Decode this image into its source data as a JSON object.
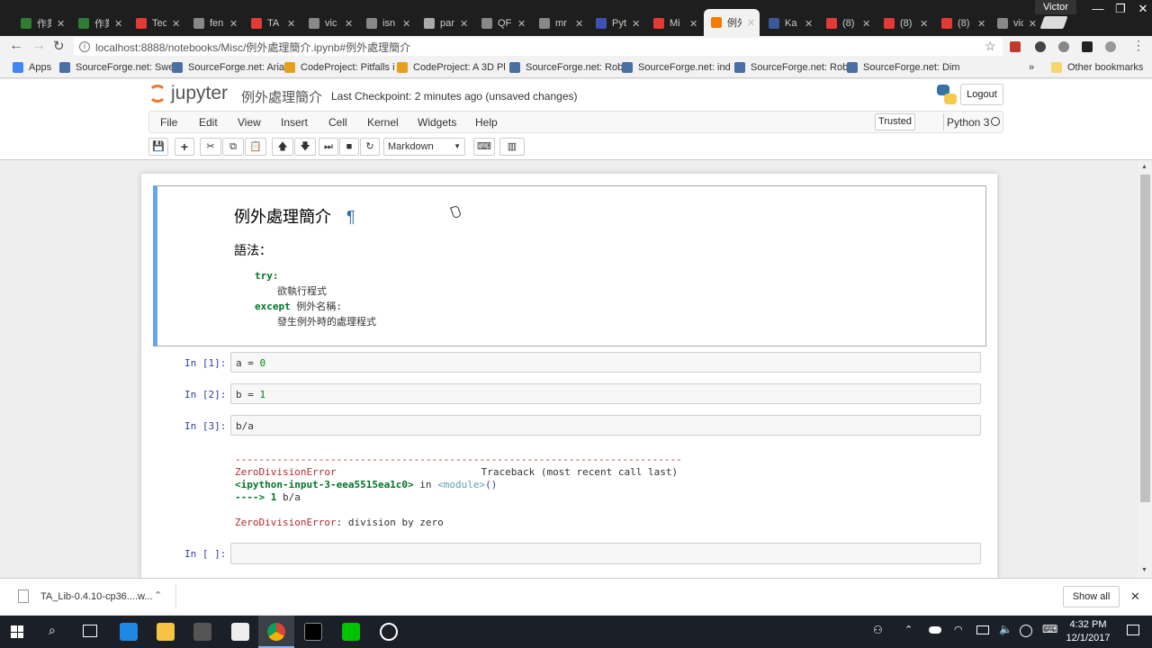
{
  "browser": {
    "tabs": [
      {
        "label": "作業",
        "color": "#2e7d32"
      },
      {
        "label": "作業",
        "color": "#2e7d32"
      },
      {
        "label": "Tec",
        "color": "#e53935"
      },
      {
        "label": "fen",
        "color": "#888888"
      },
      {
        "label": "TA",
        "color": "#e53935"
      },
      {
        "label": "vic",
        "color": "#888888"
      },
      {
        "label": "isn",
        "color": "#888888"
      },
      {
        "label": "par",
        "color": "#aaaaaa"
      },
      {
        "label": "QF",
        "color": "#888888"
      },
      {
        "label": "mr",
        "color": "#888888"
      },
      {
        "label": "Pyt",
        "color": "#3f51b5"
      },
      {
        "label": "Mi",
        "color": "#e53935"
      },
      {
        "label": "例外",
        "color": "#f57c00"
      },
      {
        "label": "Ka",
        "color": "#3b5998"
      },
      {
        "label": "(8)",
        "color": "#e53935"
      },
      {
        "label": "(8)",
        "color": "#e53935"
      },
      {
        "label": "(8)",
        "color": "#e53935"
      },
      {
        "label": "vic",
        "color": "#888888"
      }
    ],
    "profile": "Victor",
    "address": "localhost:8888/notebooks/Misc/例外處理簡介.ipynb#例外處理簡介",
    "bookmarks": [
      {
        "label": "Apps"
      },
      {
        "label": "SourceForge.net: Swe"
      },
      {
        "label": "SourceForge.net: Aria"
      },
      {
        "label": "CodeProject: Pitfalls i"
      },
      {
        "label": "CodeProject: A 3D Pl"
      },
      {
        "label": "SourceForge.net: Rob"
      },
      {
        "label": "SourceForge.net: ind"
      },
      {
        "label": "SourceForge.net: Rob"
      },
      {
        "label": "SourceForge.net: Dim"
      }
    ],
    "other_bookmarks": "Other bookmarks",
    "more": "»"
  },
  "jupyter": {
    "logo": "jupyter",
    "notebook_name": "例外處理簡介",
    "checkpoint": "Last Checkpoint: 2 minutes ago (unsaved changes)",
    "logout": "Logout",
    "menus": [
      "File",
      "Edit",
      "View",
      "Insert",
      "Cell",
      "Kernel",
      "Widgets",
      "Help"
    ],
    "trusted": "Trusted",
    "kernel": "Python 3",
    "cell_type": "Markdown"
  },
  "notebook": {
    "md_heading": "例外處理簡介",
    "pilcrow": "¶",
    "md_syntax": "語法：",
    "md_try": "try:",
    "md_try_body": "欲執行程式",
    "md_except": "except",
    "md_except_name": "例外名稱:",
    "md_except_body": "發生例外時的處理程式",
    "cells": [
      {
        "prompt": "In [1]:",
        "var": "a = ",
        "num": "0"
      },
      {
        "prompt": "In [2]:",
        "var": "b = ",
        "num": "1"
      },
      {
        "prompt": "In [3]:",
        "code": "b/a"
      },
      {
        "prompt": "In [ ]:"
      }
    ],
    "traceback": {
      "dashes": "---------------------------------------------------------------------------",
      "error_name": "ZeroDivisionError",
      "traceback_label": "Traceback (most recent call last)",
      "input_ref": "<ipython-input-3-eea5515ea1c0>",
      "in_word": " in ",
      "module": "<module>",
      "parens": "()",
      "arrow": "----> 1 ",
      "arrow_code": "b/a",
      "final_error": "ZeroDivisionError",
      "final_msg": ": division by zero"
    }
  },
  "downloads": {
    "file": "TA_Lib-0.4.10-cp36....w...",
    "show_all": "Show all"
  },
  "taskbar": {
    "time": "4:32 PM",
    "date": "12/1/2017"
  }
}
